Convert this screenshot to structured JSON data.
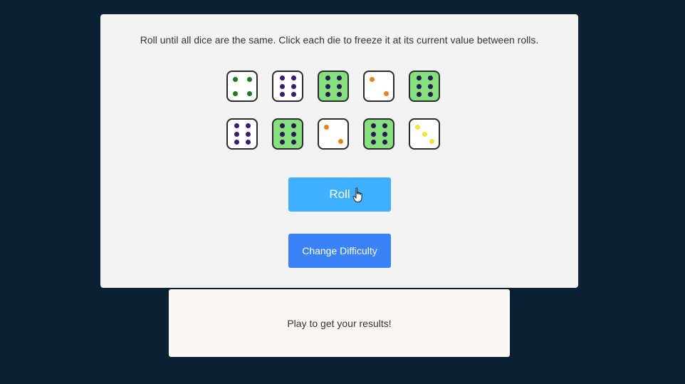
{
  "game": {
    "instructions": "Roll until all dice are the same. Click each die to freeze it at its current value between rolls.",
    "roll_label": "Roll",
    "change_difficulty_label": "Change Difficulty",
    "results_text": "Play to get your results!"
  },
  "colors": {
    "background": "#0c2033",
    "card": "#f3f3f4",
    "results_card": "#fcf8f3",
    "frozen_die": "#86e07f",
    "roll_button": "#3fb0ff",
    "difficulty_button": "#3b82f6"
  },
  "dice": [
    {
      "value": 4,
      "frozen": false,
      "pip_color": "#1f7a1f"
    },
    {
      "value": 6,
      "frozen": false,
      "pip_color": "#3a1a6b"
    },
    {
      "value": 6,
      "frozen": true,
      "pip_color": "#2a1850"
    },
    {
      "value": 2,
      "frozen": false,
      "pip_color": "#e8831c"
    },
    {
      "value": 6,
      "frozen": true,
      "pip_color": "#2a1850"
    },
    {
      "value": 6,
      "frozen": false,
      "pip_color": "#3a1a6b"
    },
    {
      "value": 6,
      "frozen": true,
      "pip_color": "#2a1850"
    },
    {
      "value": 2,
      "frozen": false,
      "pip_color": "#e8831c"
    },
    {
      "value": 6,
      "frozen": true,
      "pip_color": "#2a1850"
    },
    {
      "value": 3,
      "frozen": false,
      "pip_color": "#f5e23a"
    }
  ],
  "icons": {
    "cursor": "hand-pointer-icon"
  }
}
